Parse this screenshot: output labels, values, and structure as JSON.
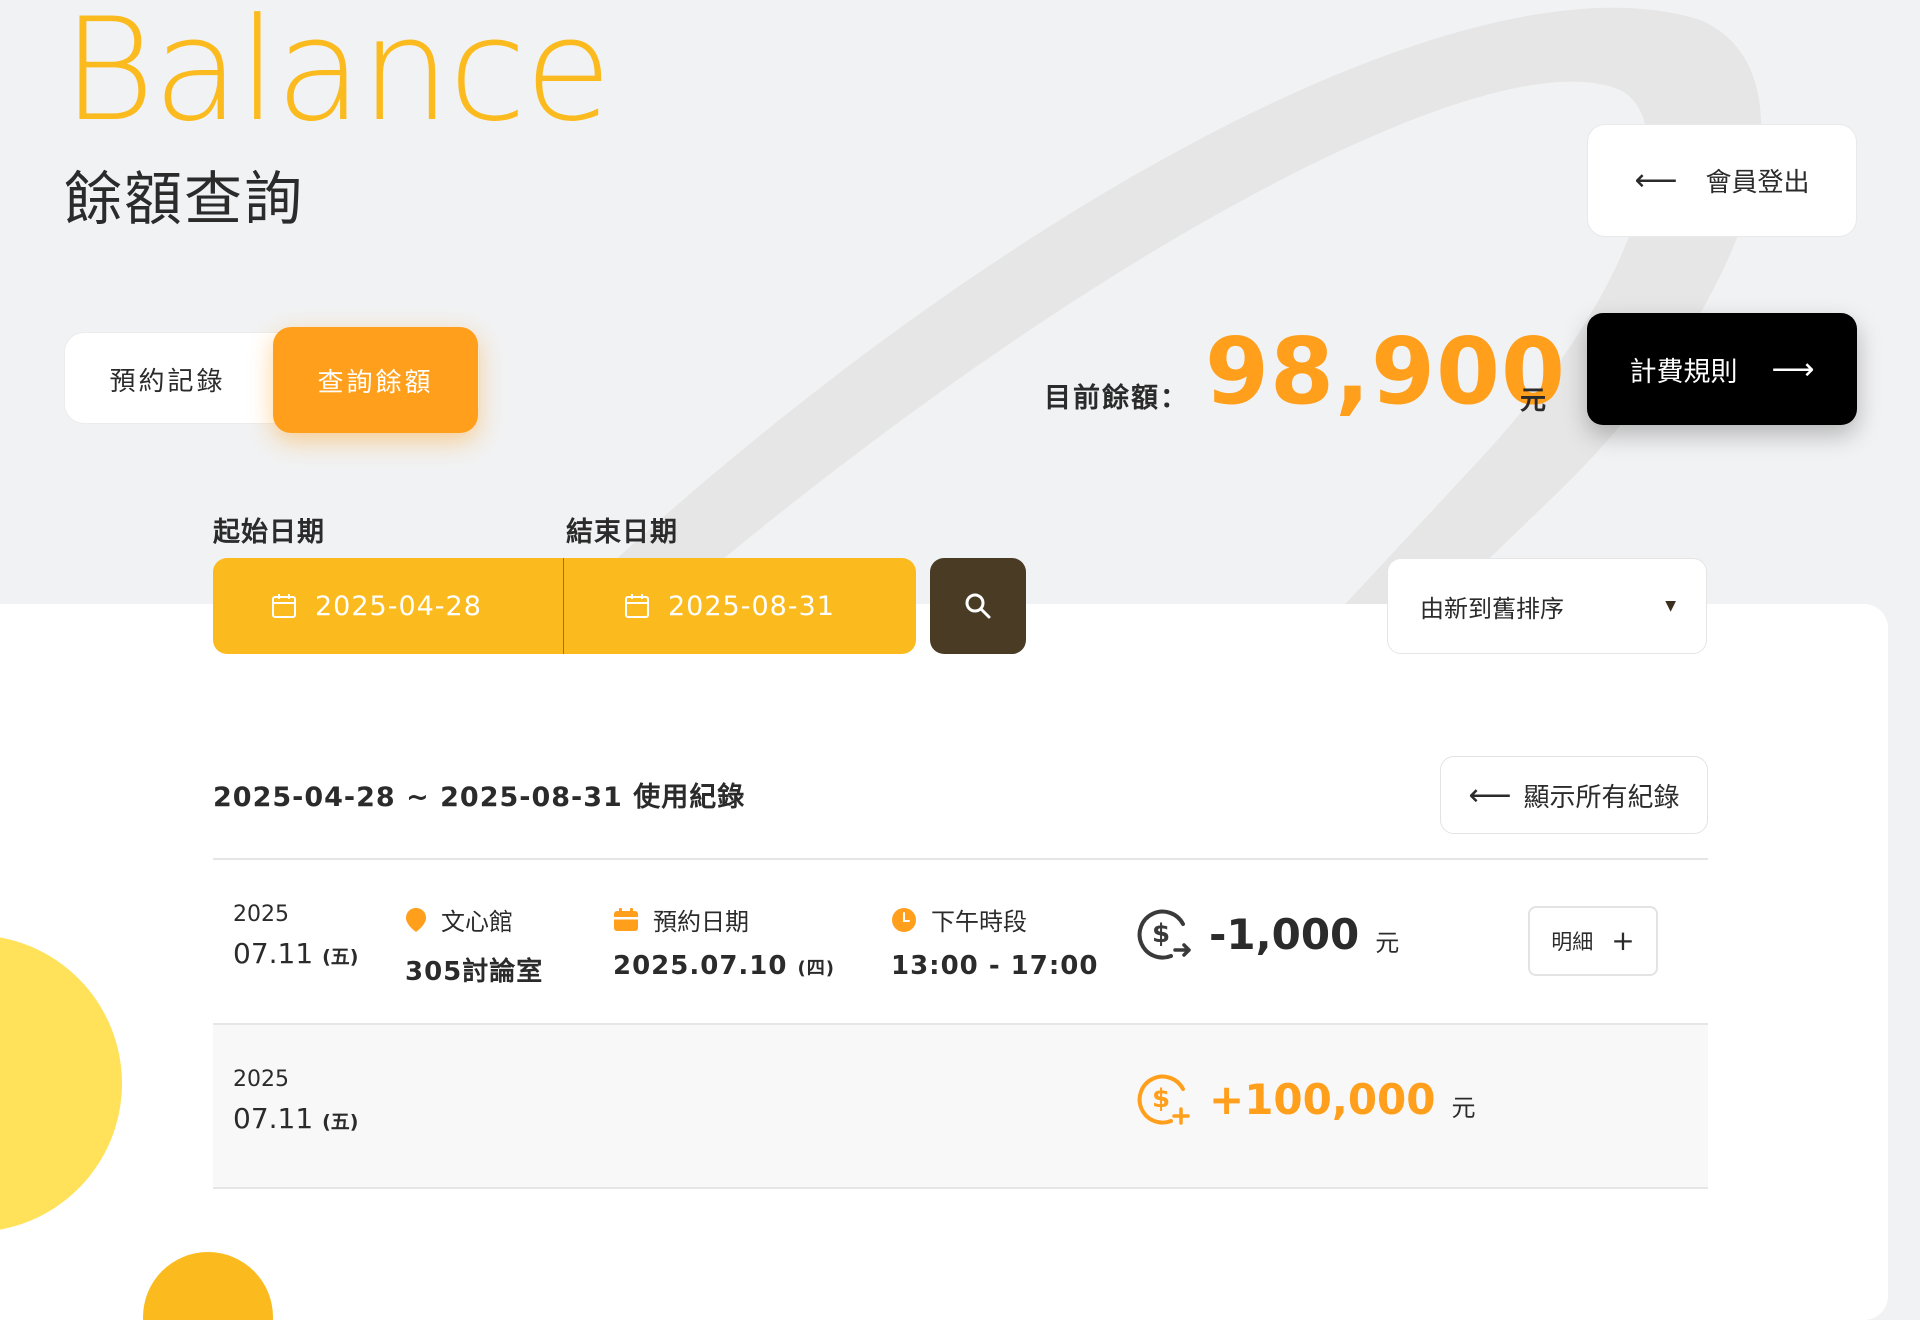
{
  "brand": "Balance",
  "page_title": "餘額查詢",
  "header": {
    "logout_label": "會員登出",
    "rules_label": "計費規則"
  },
  "tabs": [
    {
      "label": "預約記錄",
      "active": false
    },
    {
      "label": "查詢餘額",
      "active": true
    }
  ],
  "balance": {
    "label": "目前餘額：",
    "amount": "98,900",
    "unit": "元"
  },
  "filters": {
    "start_label": "起始日期",
    "end_label": "結束日期",
    "start_value": "2025-04-28",
    "end_value": "2025-08-31",
    "sort_value": "由新到舊排序"
  },
  "records": {
    "title": "2025-04-28 ~ 2025-08-31 使用紀錄",
    "show_all_label": "顯示所有紀錄",
    "rows": [
      {
        "year": "2025",
        "date": "07.11",
        "weekday": "(五)",
        "venue_label": "文心館",
        "venue_room": "305討論室",
        "booking_label": "預約日期",
        "booking_date": "2025.07.10",
        "booking_weekday": "(四)",
        "session_label": "下午時段",
        "session_time": "13:00 - 17:00",
        "amount": "-1,000",
        "unit": "元",
        "detail_label": "明細"
      },
      {
        "year": "2025",
        "date": "07.11",
        "weekday": "(五)",
        "amount": "+100,000",
        "unit": "元"
      }
    ]
  },
  "colors": {
    "accent_yellow": "#fbbb1f",
    "accent_orange": "#ff9f1c",
    "dark_brown": "#4a3b25",
    "black": "#000000"
  },
  "icons": [
    "arrow-left-icon",
    "arrow-right-icon",
    "calendar-icon",
    "search-icon",
    "caret-down-icon",
    "location-pin-icon",
    "calendar-booking-icon",
    "clock-icon",
    "coin-minus-icon",
    "coin-plus-icon",
    "plus-icon"
  ]
}
